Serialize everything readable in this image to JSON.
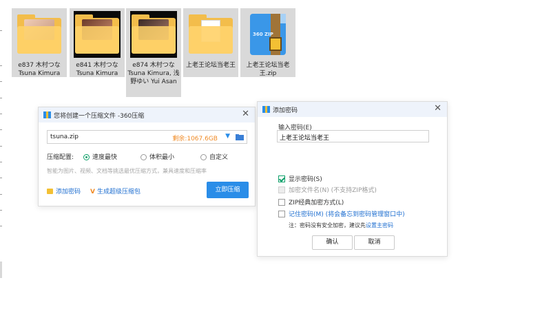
{
  "files": [
    {
      "name": "e837 木村つな Tsuna Kimura",
      "thumb": "folder-photo"
    },
    {
      "name": "e841 木村つな Tsuna Kimura",
      "thumb": "folder-photo"
    },
    {
      "name": "e874 木村つな Tsuna Kimura, 浅野ゆい Yui Asan",
      "thumb": "folder-photo"
    },
    {
      "name": "上老王论坛当老王",
      "thumb": "folder-document"
    },
    {
      "name": "上老王论坛当老王.zip",
      "thumb": "zip-archive"
    }
  ],
  "zip_icon_text": "360 ZIP",
  "compress_dialog": {
    "title": "您将创建一个压缩文件 -360压缩",
    "filename": "tsuna.zip",
    "remaining": "剩余:1067.6GB",
    "config_label": "压缩配置:",
    "options": [
      "速度最快",
      "体积最小",
      "自定义"
    ],
    "selected_option": "速度最快",
    "hint": "智能为图片、视频、文档等挑选最优压缩方式，兼具速度和压缩率",
    "add_password": "添加密码",
    "super_package": "生成超级压缩包",
    "start_button": "立即压缩"
  },
  "password_dialog": {
    "title": "添加密码",
    "input_label": "输入密码(E)",
    "password_value": "上老王论坛当老王",
    "show_password": "显示密码(S)",
    "encrypt_filenames": "加密文件名(N) (不支持ZIP格式)",
    "zip_classic": "ZIP经典加密方式(L)",
    "remember_password": "记住密码(M) (将会备忘到密码管理窗口中)",
    "note_prefix": "注：密码没有安全加密，建议先",
    "note_link": "设置主密码",
    "ok_button": "确认",
    "cancel_button": "取消"
  },
  "colors": {
    "accent": "#2a8de8",
    "folder": "#ffd36b",
    "check": "#0ea06a",
    "orange": "#f08a24"
  }
}
